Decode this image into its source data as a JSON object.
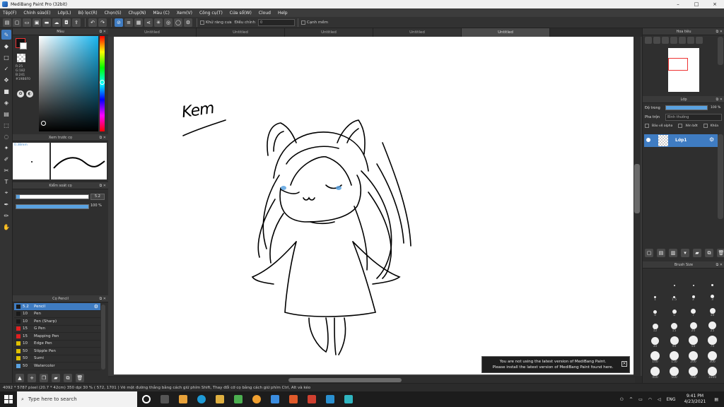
{
  "window": {
    "title": "MediBang Paint Pro (32bit)",
    "min": "–",
    "max": "□",
    "close": "×"
  },
  "menu": [
    "Tệp(F)",
    "Chỉnh sửa(E)",
    "Lớp(L)",
    "Bộ lọc(R)",
    "Chọn(S)",
    "Chụp(N)",
    "Màu (C)",
    "Xem(V)",
    "Công cụ(T)",
    "Cửa sổ(W)",
    "Cloud",
    "Help"
  ],
  "toolbar": {
    "antialias_label": "Khử răng cưa",
    "correction_label": "Điều chỉnh",
    "correction_value": "0",
    "snap_label": "Cạnh mềm"
  },
  "tabs": [
    "Untitled",
    "Untitled",
    "Untitled",
    "Untitled",
    "Untitled"
  ],
  "color_panel": {
    "title": "Màu",
    "r": "R:25",
    "g": "G:182",
    "b": "B:241",
    "hex": "#19B6F0"
  },
  "brush_preview": {
    "title": "Xem trước cọ",
    "size": "0.38mm"
  },
  "brush_size_panel": {
    "title": "Kiểm soát cọ",
    "size_value": "5.2",
    "opacity_value": "100 %",
    "size_fraction": 0.05,
    "opacity_fraction": 1.0
  },
  "brush_list": {
    "title": "Cọ Pencil",
    "items": [
      {
        "size": "5.2",
        "name": "Pencil",
        "color": "#1a1a1a",
        "selected": true
      },
      {
        "size": "10",
        "name": "Pen",
        "color": "#1a1a1a"
      },
      {
        "size": "10",
        "name": "Pen (Sharp)",
        "color": "#1a1a1a"
      },
      {
        "size": "15",
        "name": "G Pen",
        "color": "#e02020"
      },
      {
        "size": "15",
        "name": "Mapping Pen",
        "color": "#e02020"
      },
      {
        "size": "10",
        "name": "Edge Pen",
        "color": "#e0c000"
      },
      {
        "size": "50",
        "name": "Stipple Pen",
        "color": "#e0c000"
      },
      {
        "size": "50",
        "name": "Sumi",
        "color": "#e0c000"
      },
      {
        "size": "50",
        "name": "Watercolor",
        "color": "#5aa2e0"
      }
    ]
  },
  "canvas": {
    "handwriting": "Kem"
  },
  "notice": {
    "line1": "You are not using the latest version of MediBang Paint.",
    "line2": "Please install the latest version of MediBang Paint found here.",
    "close": "×"
  },
  "navigator": {
    "title": "Hoa tiêu"
  },
  "layers": {
    "title": "Lớp",
    "opacity_label": "Độ trong",
    "opacity_value": "100 %",
    "opacity_fraction": 1.0,
    "blend_label": "Pha trộn",
    "blend_value": "Bình thường",
    "protect_alpha": "Bảo vệ alpha",
    "clipping": "Xén bớt",
    "lock": "Khóa",
    "layer_name": "Lớp1"
  },
  "brush_sizes": {
    "title": "Brush Size",
    "labels": [
      "",
      "",
      "",
      "",
      "1",
      "1.5",
      "2",
      "3",
      "4",
      "5",
      "7",
      "10",
      "12",
      "15",
      "20",
      "25",
      "30",
      "40",
      "50",
      "70",
      "100",
      "150",
      "200",
      "300",
      "400",
      "500",
      "700",
      "1000"
    ]
  },
  "statusbar": {
    "text": "4092 * 5787 pixel  (20.7 * 42cm)  350 dpi  30 %  ( 572, 1701 )  Vẽ một đường thẳng bằng cách giữ phím Shift, Thay đổi cỡ cọ bằng cách giữ phím Ctrl, Alt và kéo"
  },
  "taskbar": {
    "search_placeholder": "Type here to search",
    "lang": "ENG",
    "time": "9:41 PM",
    "date": "4/23/2021"
  }
}
